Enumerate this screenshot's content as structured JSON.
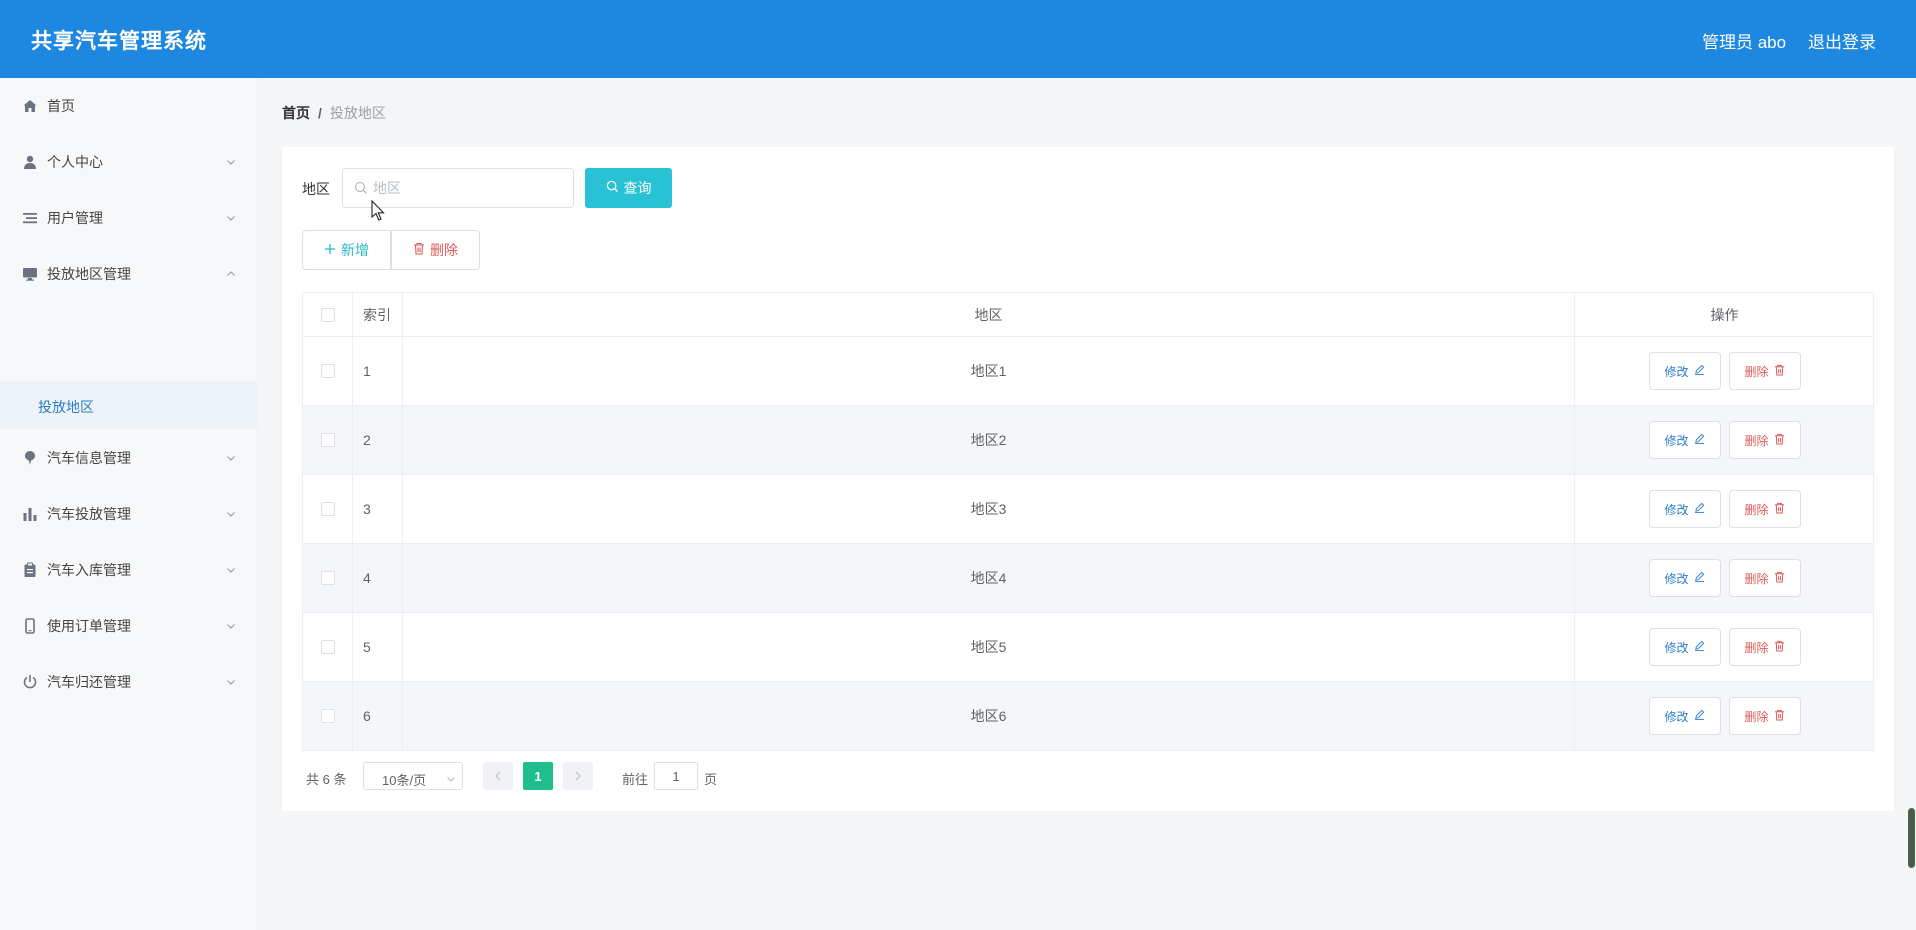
{
  "header": {
    "brand": "共享汽车管理系统",
    "user": "管理员 abo",
    "logout": "退出登录",
    "bg_color": "#1e88e0"
  },
  "sidebar": {
    "items": [
      {
        "label": "首页",
        "icon": "home-icon",
        "expandable": false
      },
      {
        "label": "个人中心",
        "icon": "user-icon",
        "expandable": true
      },
      {
        "label": "用户管理",
        "icon": "list-icon",
        "expandable": true
      },
      {
        "label": "投放地区管理",
        "icon": "monitor-icon",
        "expandable": true,
        "expanded": true
      },
      {
        "label": "汽车信息管理",
        "icon": "pin-icon",
        "expandable": true
      },
      {
        "label": "汽车投放管理",
        "icon": "bar-chart-icon",
        "expandable": true
      },
      {
        "label": "汽车入库管理",
        "icon": "clipboard-icon",
        "expandable": true
      },
      {
        "label": "使用订单管理",
        "icon": "phone-icon",
        "expandable": true
      },
      {
        "label": "汽车归还管理",
        "icon": "power-icon",
        "expandable": true
      }
    ],
    "sub_item": "投放地区"
  },
  "breadcrumb": {
    "home": "首页",
    "separator": "/",
    "current": "投放地区"
  },
  "search": {
    "label": "地区",
    "placeholder": "地区",
    "value": "",
    "query_button": "查询"
  },
  "actions": {
    "add": "新增",
    "delete": "删除"
  },
  "table": {
    "headers": {
      "index": "索引",
      "area": "地区",
      "ops": "操作"
    },
    "rows": [
      {
        "index": "1",
        "area": "地区1"
      },
      {
        "index": "2",
        "area": "地区2"
      },
      {
        "index": "3",
        "area": "地区3"
      },
      {
        "index": "4",
        "area": "地区4"
      },
      {
        "index": "5",
        "area": "地区5"
      },
      {
        "index": "6",
        "area": "地区6"
      }
    ],
    "edit_label": "修改",
    "delete_label": "删除"
  },
  "pagination": {
    "total": "共 6 条",
    "page_size": "10条/页",
    "current_page": "1",
    "goto_prefix": "前往",
    "goto_value": "1",
    "goto_suffix": "页"
  }
}
